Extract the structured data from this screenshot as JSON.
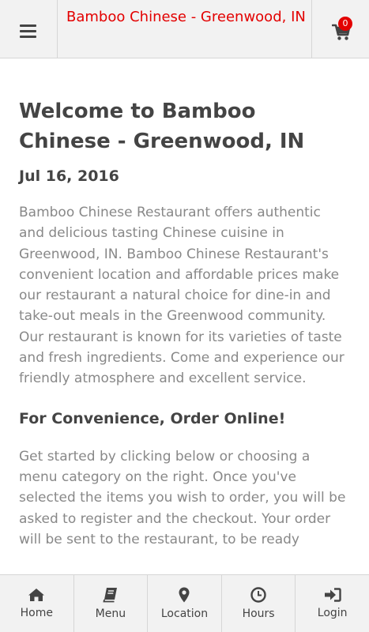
{
  "header": {
    "title": "Bamboo Chinese - Greenwood, IN",
    "cart_count": "0"
  },
  "article": {
    "heading": "Welcome to Bamboo Chinese - Greenwood, IN",
    "date": "Jul 16, 2016",
    "intro": "Bamboo Chinese Restaurant offers authentic and delicious tasting Chinese cuisine in Greenwood, IN. Bamboo Chinese Restaurant's convenient location and affordable prices make our restaurant a natural choice for dine-in and take-out meals in the Greenwood community. Our restaurant is known for its varieties of taste and fresh ingredients. Come and experience our friendly atmosphere and excellent service.",
    "subheading": "For Convenience, Order Online!",
    "body": "Get started by clicking below or choosing a menu category on the right. Once you've selected the items you wish to order, you will be asked to register and the checkout. Your order will be sent to the restaurant, to be ready"
  },
  "nav": {
    "items": [
      {
        "label": "Home",
        "icon": "home-icon"
      },
      {
        "label": "Menu",
        "icon": "book-icon"
      },
      {
        "label": "Location",
        "icon": "map-marker-icon"
      },
      {
        "label": "Hours",
        "icon": "clock-icon"
      },
      {
        "label": "Login",
        "icon": "sign-in-icon"
      }
    ]
  },
  "colors": {
    "brand": "#e30000",
    "text": "#444444",
    "muted": "#888888",
    "bar_bg": "#f2f2f2"
  }
}
